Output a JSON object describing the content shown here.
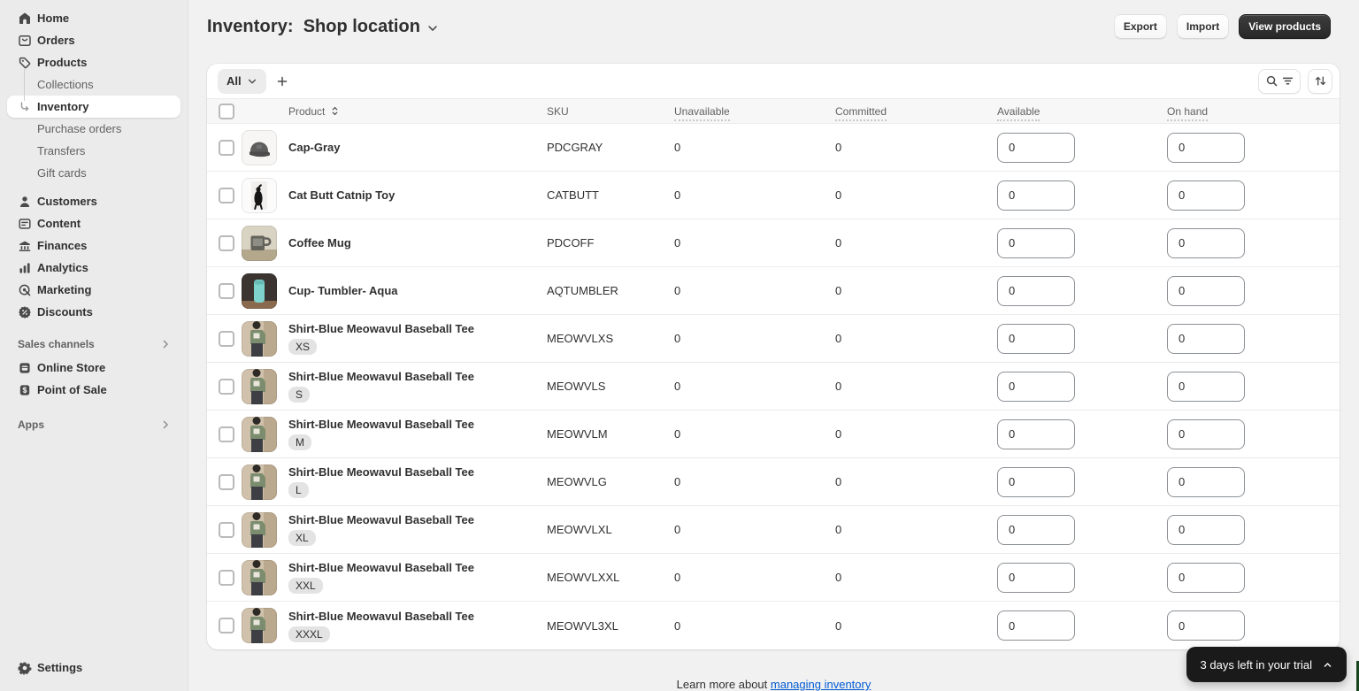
{
  "sidebar": {
    "items": [
      {
        "label": "Home",
        "icon": "home"
      },
      {
        "label": "Orders",
        "icon": "orders"
      },
      {
        "label": "Products",
        "icon": "products",
        "children": [
          {
            "label": "Collections"
          },
          {
            "label": "Inventory",
            "selected": true
          },
          {
            "label": "Purchase orders"
          },
          {
            "label": "Transfers"
          },
          {
            "label": "Gift cards"
          }
        ]
      },
      {
        "label": "Customers",
        "icon": "customers"
      },
      {
        "label": "Content",
        "icon": "content"
      },
      {
        "label": "Finances",
        "icon": "finances"
      },
      {
        "label": "Analytics",
        "icon": "analytics"
      },
      {
        "label": "Marketing",
        "icon": "marketing"
      },
      {
        "label": "Discounts",
        "icon": "discounts"
      }
    ],
    "sections": [
      {
        "label": "Sales channels",
        "items": [
          {
            "label": "Online Store",
            "icon": "online-store"
          },
          {
            "label": "Point of Sale",
            "icon": "pos"
          }
        ]
      },
      {
        "label": "Apps",
        "items": []
      }
    ],
    "settings_label": "Settings"
  },
  "header": {
    "title": "Inventory:",
    "location": "Shop location",
    "export_label": "Export",
    "import_label": "Import",
    "view_products_label": "View products"
  },
  "filter_bar": {
    "tab": "All"
  },
  "table": {
    "columns": {
      "product": "Product",
      "sku": "SKU",
      "unavailable": "Unavailable",
      "committed": "Committed",
      "available": "Available",
      "on_hand": "On hand"
    },
    "rows": [
      {
        "name": "Cap-Gray",
        "sku": "PDCGRAY",
        "unavailable": "0",
        "committed": "0",
        "available": "0",
        "on_hand": "0",
        "thumb": "cap"
      },
      {
        "name": "Cat Butt Catnip Toy",
        "sku": "CATBUTT",
        "unavailable": "0",
        "committed": "0",
        "available": "0",
        "on_hand": "0",
        "thumb": "cat"
      },
      {
        "name": "Coffee Mug",
        "sku": "PDCOFF",
        "unavailable": "0",
        "committed": "0",
        "available": "0",
        "on_hand": "0",
        "thumb": "mug"
      },
      {
        "name": "Cup- Tumbler- Aqua",
        "sku": "AQTUMBLER",
        "unavailable": "0",
        "committed": "0",
        "available": "0",
        "on_hand": "0",
        "thumb": "tumbler"
      },
      {
        "name": "Shirt-Blue Meowavul Baseball Tee",
        "size": "XS",
        "sku": "MEOWVLXS",
        "unavailable": "0",
        "committed": "0",
        "available": "0",
        "on_hand": "0",
        "thumb": "shirt"
      },
      {
        "name": "Shirt-Blue Meowavul Baseball Tee",
        "size": "S",
        "sku": "MEOWVLS",
        "unavailable": "0",
        "committed": "0",
        "available": "0",
        "on_hand": "0",
        "thumb": "shirt"
      },
      {
        "name": "Shirt-Blue Meowavul Baseball Tee",
        "size": "M",
        "sku": "MEOWVLM",
        "unavailable": "0",
        "committed": "0",
        "available": "0",
        "on_hand": "0",
        "thumb": "shirt"
      },
      {
        "name": "Shirt-Blue Meowavul Baseball Tee",
        "size": "L",
        "sku": "MEOWVLG",
        "unavailable": "0",
        "committed": "0",
        "available": "0",
        "on_hand": "0",
        "thumb": "shirt"
      },
      {
        "name": "Shirt-Blue Meowavul Baseball Tee",
        "size": "XL",
        "sku": "MEOWVLXL",
        "unavailable": "0",
        "committed": "0",
        "available": "0",
        "on_hand": "0",
        "thumb": "shirt"
      },
      {
        "name": "Shirt-Blue Meowavul Baseball Tee",
        "size": "XXL",
        "sku": "MEOWVLXXL",
        "unavailable": "0",
        "committed": "0",
        "available": "0",
        "on_hand": "0",
        "thumb": "shirt"
      },
      {
        "name": "Shirt-Blue Meowavul Baseball Tee",
        "size": "XXXL",
        "sku": "MEOWVL3XL",
        "unavailable": "0",
        "committed": "0",
        "available": "0",
        "on_hand": "0",
        "thumb": "shirt"
      }
    ]
  },
  "footer": {
    "text": "Learn more about",
    "link": "managing inventory"
  },
  "toast": {
    "text": "3 days left in your trial"
  }
}
